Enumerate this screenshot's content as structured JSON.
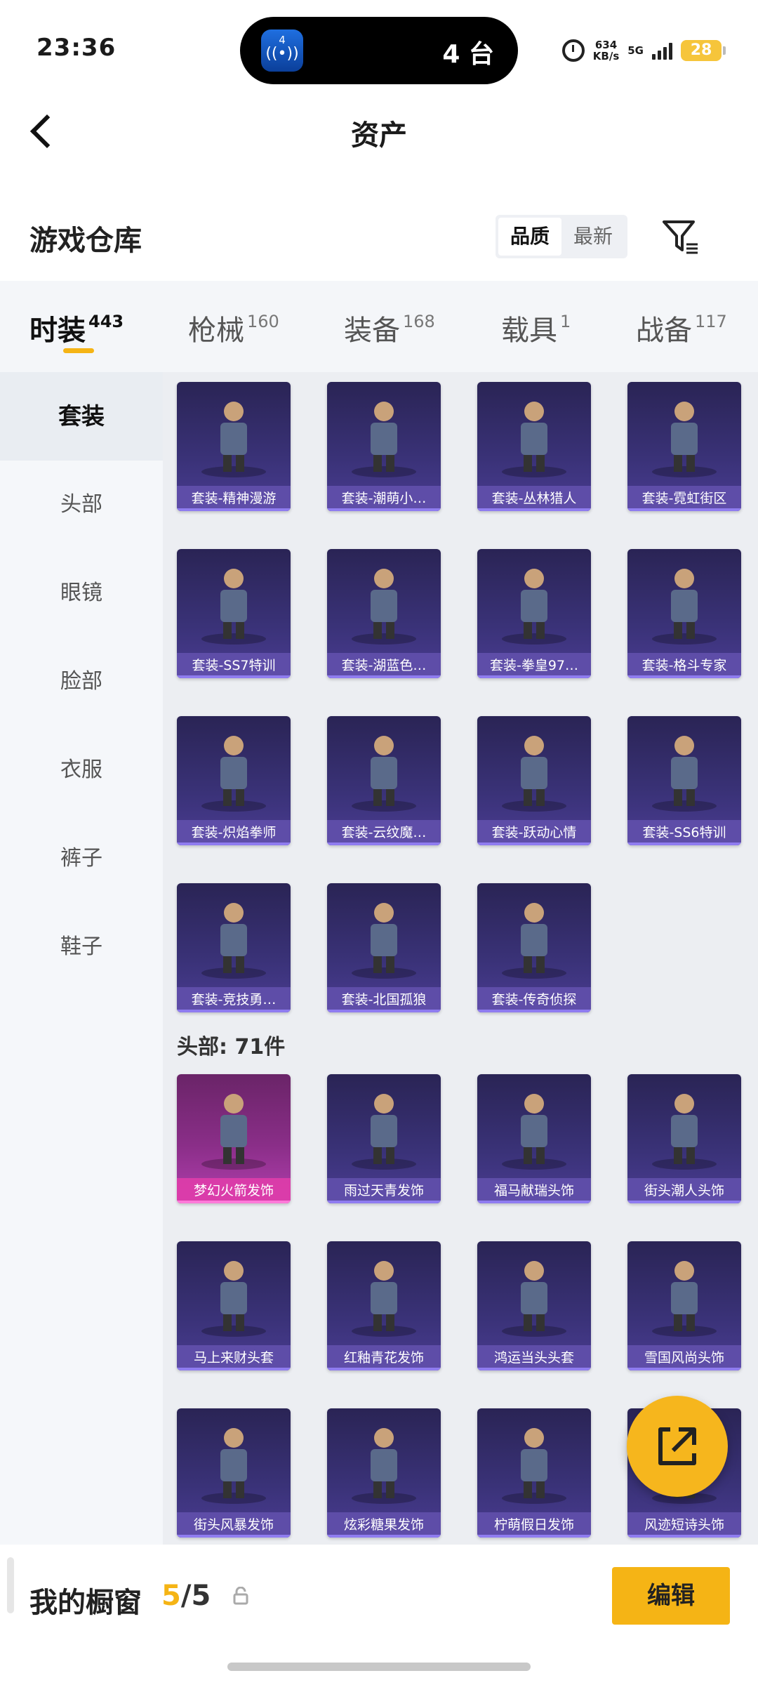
{
  "status_bar": {
    "time": "23:36",
    "island_badge": "4",
    "island_text": "4 台",
    "net_speed_value": "634",
    "net_speed_unit": "KB/s",
    "network": "5G",
    "battery": "28"
  },
  "header": {
    "title": "资产"
  },
  "section": {
    "title": "游戏仓库",
    "sort_options": [
      "品质",
      "最新"
    ],
    "active_sort": "品质"
  },
  "category_tabs": [
    {
      "label": "时装",
      "count": "443",
      "active": true
    },
    {
      "label": "枪械",
      "count": "160",
      "active": false
    },
    {
      "label": "装备",
      "count": "168",
      "active": false
    },
    {
      "label": "载具",
      "count": "1",
      "active": false
    },
    {
      "label": "战备",
      "count": "117",
      "active": false
    }
  ],
  "sidebar": {
    "items": [
      "套装",
      "头部",
      "眼镜",
      "脸部",
      "衣服",
      "裤子",
      "鞋子"
    ],
    "active": "套装"
  },
  "outfit_items": [
    "套装-精神漫游",
    "套装-潮萌小…",
    "套装-丛林猎人",
    "套装-霓虹街区",
    "套装-SS7特训",
    "套装-湖蓝色…",
    "套装-拳皇97…",
    "套装-格斗专家",
    "套装-炽焰拳师",
    "套装-云纹魔…",
    "套装-跃动心情",
    "套装-SS6特训",
    "套装-竞技勇…",
    "套装-北国孤狼",
    "套装-传奇侦探"
  ],
  "head_group": {
    "label": "头部: 71件",
    "items": [
      "梦幻火箭发饰",
      "雨过天青发饰",
      "福马献瑞头饰",
      "街头潮人头饰",
      "马上来财头套",
      "红釉青花发饰",
      "鸿运当头头套",
      "雪国风尚头饰",
      "街头风暴发饰",
      "炫彩糖果发饰",
      "柠萌假日发饰",
      "风迹短诗头饰"
    ]
  },
  "bottom_bar": {
    "title": "我的橱窗",
    "count_current": "5",
    "count_total": "/5",
    "edit_label": "编辑"
  },
  "colors": {
    "accent": "#f5b415",
    "card_bg": "#3a3278",
    "card_label": "#604eaa",
    "card_highlight": "#b23fae"
  }
}
